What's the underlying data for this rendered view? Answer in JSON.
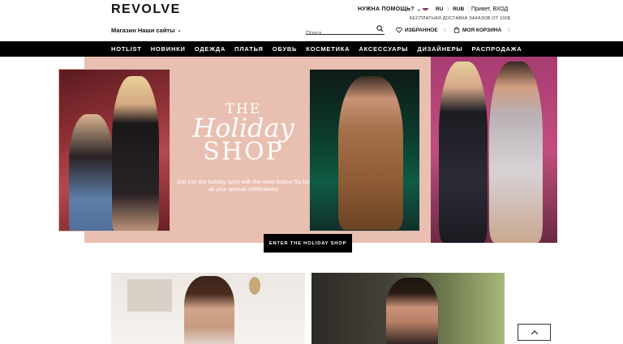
{
  "header": {
    "logo": "REVOLVE",
    "help": "НУЖНА ПОМОЩЬ?",
    "language": "RU",
    "currency": "RUB",
    "greeting": "Привет, ВХОД",
    "shipping": "БЕСПЛАТНАЯ ДОСТАВКА ЗАКАЗОВ ОТ 100$",
    "stores": "Магазин Наши сайты",
    "search_placeholder": "Поиск",
    "favorites_label": "ИЗБРАННОЕ",
    "favorites_count": "0",
    "cart_label": "МОЯ КОРЗИНА",
    "cart_count": "0"
  },
  "nav": {
    "items": [
      "HOTLIST",
      "НОВИНКИ",
      "ОДЕЖДА",
      "ПЛАТЬЯ",
      "ОБУВЬ",
      "КОСМЕТИКА",
      "АКСЕССУАРЫ",
      "ДИЗАЙНЕРЫ",
      "РАСПРОДАЖА"
    ]
  },
  "hero": {
    "title_the": "THE",
    "title_holiday": "Holiday",
    "title_shop": "SHOP",
    "description": "Get into the holiday spirit with the most festive fits for all your special celebrations",
    "cta": "ENTER THE HOLIDAY SHOP"
  },
  "colors": {
    "hero_bg": "#e8bfb1",
    "nav_bg": "#000000",
    "count_accent": "#e4a2a9"
  }
}
